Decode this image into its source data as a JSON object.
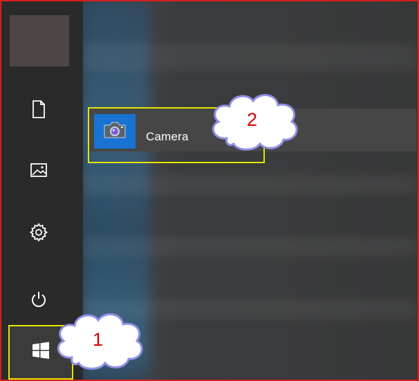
{
  "start_menu": {
    "rail": {
      "items": [
        {
          "icon": "document-icon"
        },
        {
          "icon": "pictures-icon"
        },
        {
          "icon": "settings-gear-icon"
        },
        {
          "icon": "power-icon"
        }
      ],
      "start_button": {
        "icon": "windows-logo-icon"
      }
    },
    "app_list": {
      "items": [
        {
          "label": "Camera",
          "icon": "camera-icon",
          "tile_color": "#1873d3"
        }
      ]
    }
  },
  "annotations": {
    "callouts": [
      {
        "number": "1",
        "target": "start-button"
      },
      {
        "number": "2",
        "target": "camera-app-item"
      }
    ],
    "highlight_color": "#e6e600",
    "number_color": "#d60000",
    "frame_color": "#d81e1e"
  }
}
